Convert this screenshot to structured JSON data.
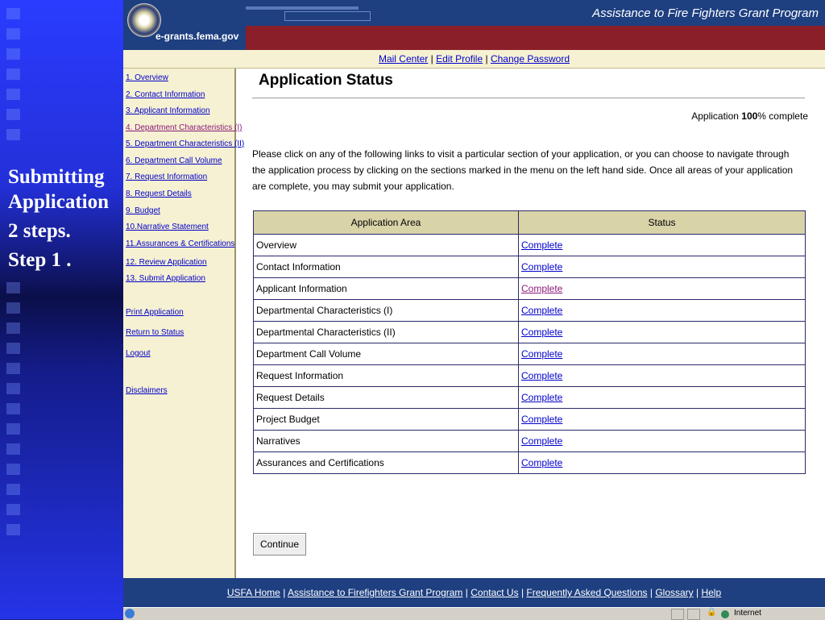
{
  "slide": {
    "lines": [
      "Submitting",
      "Application",
      "2 steps.",
      "Step 1 ."
    ]
  },
  "header": {
    "site_name": "e-grants.fema.gov",
    "program_title": "Assistance to Fire Fighters Grant Program",
    "seal_icon": "fema-seal-icon"
  },
  "topnav": {
    "mail_center": "Mail Center",
    "edit_profile": "Edit Profile",
    "change_password": "Change Password",
    "separator": "|"
  },
  "sidebar": {
    "items": [
      {
        "label": "1. Overview"
      },
      {
        "label": "2. Contact Information"
      },
      {
        "label": "3. Applicant Information"
      },
      {
        "label": "4. Department Characteristics (I)"
      },
      {
        "label": "5. Department Characteristics (II)"
      },
      {
        "label": "6. Department Call Volume"
      },
      {
        "label": "7. Request Information"
      },
      {
        "label": "8. Request Details"
      },
      {
        "label": "9. Budget"
      },
      {
        "label": "10.Narrative Statement"
      },
      {
        "label": "11.Assurances & Certifications"
      },
      {
        "label": "12. Review Application"
      },
      {
        "label": "13. Submit Application"
      }
    ],
    "links": [
      {
        "label": "Print Application"
      },
      {
        "label": "Return to Status"
      },
      {
        "label": "Logout"
      },
      {
        "label": "Disclaimers"
      }
    ]
  },
  "main": {
    "title": "Application Status",
    "progress_prefix": "Application ",
    "progress_value": "100",
    "progress_suffix": "% complete",
    "intro": "Please click on any of the following links to visit a particular section of your application, or you can choose to navigate through the application process by clicking on the sections marked in the menu on the left hand side. Once all areas of your application are complete, you may submit your application.",
    "table": {
      "headers": [
        "Application Area",
        "Status"
      ],
      "rows": [
        {
          "area": "Overview",
          "status": "Complete"
        },
        {
          "area": "Contact Information",
          "status": "Complete"
        },
        {
          "area": "Applicant Information",
          "status": "Complete"
        },
        {
          "area": "Departmental Characteristics (I)",
          "status": "Complete"
        },
        {
          "area": "Departmental Characteristics (II)",
          "status": "Complete"
        },
        {
          "area": "Department Call Volume",
          "status": "Complete"
        },
        {
          "area": "Request Information",
          "status": "Complete"
        },
        {
          "area": "Request Details",
          "status": "Complete"
        },
        {
          "area": "Project Budget",
          "status": "Complete"
        },
        {
          "area": "Narratives",
          "status": "Complete"
        },
        {
          "area": "Assurances and Certifications",
          "status": "Complete"
        }
      ]
    },
    "continue_label": "Continue"
  },
  "footer": {
    "links": [
      "USFA Home",
      "Assistance to Firefighters Grant Program",
      "Contact Us",
      "Frequently Asked Questions",
      "Glossary",
      "Help"
    ],
    "separator": "|"
  },
  "statusbar": {
    "zone": "Internet"
  },
  "colors": {
    "header_blue": "#1e3f80",
    "header_red": "#8a1f2a",
    "panel_beige": "#f6f1d2",
    "table_header": "#d9d3a8",
    "link": "#0000cc",
    "visited_link": "#8b1a7a"
  }
}
